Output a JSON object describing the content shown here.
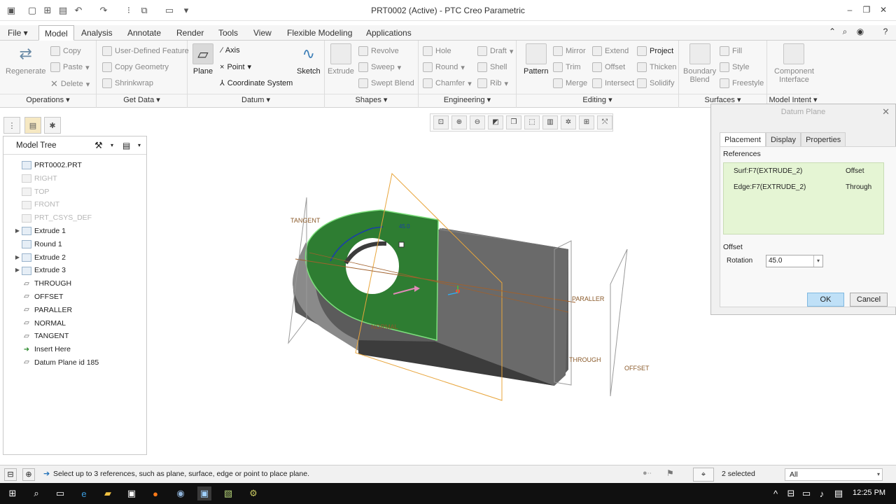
{
  "window": {
    "title": "PRT0002 (Active) - PTC Creo Parametric"
  },
  "tabs": [
    "File",
    "Model",
    "Analysis",
    "Annotate",
    "Render",
    "Tools",
    "View",
    "Flexible Modeling",
    "Applications"
  ],
  "ribbon": {
    "operations": {
      "regenerate": "Regenerate",
      "copy": "Copy",
      "paste": "Paste",
      "delete": "Delete",
      "label": "Operations"
    },
    "getdata": {
      "udf": "User-Defined Feature",
      "copy_geom": "Copy Geometry",
      "shrinkwrap": "Shrinkwrap",
      "label": "Get Data"
    },
    "datum": {
      "plane": "Plane",
      "axis": "Axis",
      "point": "Point",
      "csys": "Coordinate System",
      "sketch": "Sketch",
      "label": "Datum"
    },
    "shapes": {
      "extrude": "Extrude",
      "revolve": "Revolve",
      "sweep": "Sweep",
      "swept_blend": "Swept Blend",
      "label": "Shapes"
    },
    "engineering": {
      "hole": "Hole",
      "round": "Round",
      "chamfer": "Chamfer",
      "draft": "Draft",
      "shell": "Shell",
      "rib": "Rib",
      "label": "Engineering"
    },
    "editing": {
      "pattern": "Pattern",
      "mirror": "Mirror",
      "trim": "Trim",
      "merge": "Merge",
      "extend": "Extend",
      "offset": "Offset",
      "intersect": "Intersect",
      "project": "Project",
      "thicken": "Thicken",
      "solidify": "Solidify",
      "label": "Editing"
    },
    "surfaces": {
      "boundary": "Boundary",
      "blend": "Blend",
      "fill": "Fill",
      "style": "Style",
      "freestyle": "Freestyle",
      "label": "Surfaces"
    },
    "intent": {
      "component": "Component",
      "interface": "Interface",
      "label": "Model Intent"
    }
  },
  "model_tree": {
    "title": "Model Tree",
    "items": [
      {
        "label": "PRT0002.PRT",
        "dim": false,
        "expand": ""
      },
      {
        "label": "RIGHT",
        "dim": true,
        "expand": ""
      },
      {
        "label": "TOP",
        "dim": true,
        "expand": ""
      },
      {
        "label": "FRONT",
        "dim": true,
        "expand": ""
      },
      {
        "label": "PRT_CSYS_DEF",
        "dim": true,
        "expand": ""
      },
      {
        "label": "Extrude 1",
        "dim": false,
        "expand": "▶"
      },
      {
        "label": "Round 1",
        "dim": false,
        "expand": ""
      },
      {
        "label": "Extrude 2",
        "dim": false,
        "expand": "▶"
      },
      {
        "label": "Extrude 3",
        "dim": false,
        "expand": "▶"
      },
      {
        "label": "THROUGH",
        "dim": false,
        "expand": ""
      },
      {
        "label": "OFFSET",
        "dim": false,
        "expand": ""
      },
      {
        "label": "PARALLER",
        "dim": false,
        "expand": ""
      },
      {
        "label": "NORMAL",
        "dim": false,
        "expand": ""
      },
      {
        "label": "TANGENT",
        "dim": false,
        "expand": ""
      },
      {
        "label": "Insert Here",
        "dim": false,
        "expand": ""
      },
      {
        "label": "Datum Plane id 185",
        "dim": false,
        "expand": ""
      }
    ]
  },
  "viewport": {
    "labels": {
      "tangent": "TANGENT",
      "normal": "NORMAL",
      "paraller": "PARALLER",
      "through": "THROUGH",
      "offset": "OFFSET",
      "angle": "45.0"
    }
  },
  "dialog": {
    "title": "Datum Plane",
    "tabs": [
      "Placement",
      "Display",
      "Properties"
    ],
    "references_label": "References",
    "references": [
      {
        "ref": "Surf:F7(EXTRUDE_2)",
        "type": "Offset"
      },
      {
        "ref": "Edge:F7(EXTRUDE_2)",
        "type": "Through"
      }
    ],
    "offset_label": "Offset",
    "rotation_label": "Rotation",
    "rotation_value": "45.0",
    "ok": "OK",
    "cancel": "Cancel"
  },
  "status": {
    "message": "Select up to 3 references, such as plane, surface, edge or point to place plane.",
    "selected": "2 selected",
    "filter": "All"
  },
  "taskbar": {
    "time": "12:25 PM"
  },
  "colors": {
    "green_face": "#2e7d32",
    "gray_body": "#6e6e6e",
    "datum_orange": "#e8a53c",
    "ok_blue": "#bfe0f7"
  }
}
